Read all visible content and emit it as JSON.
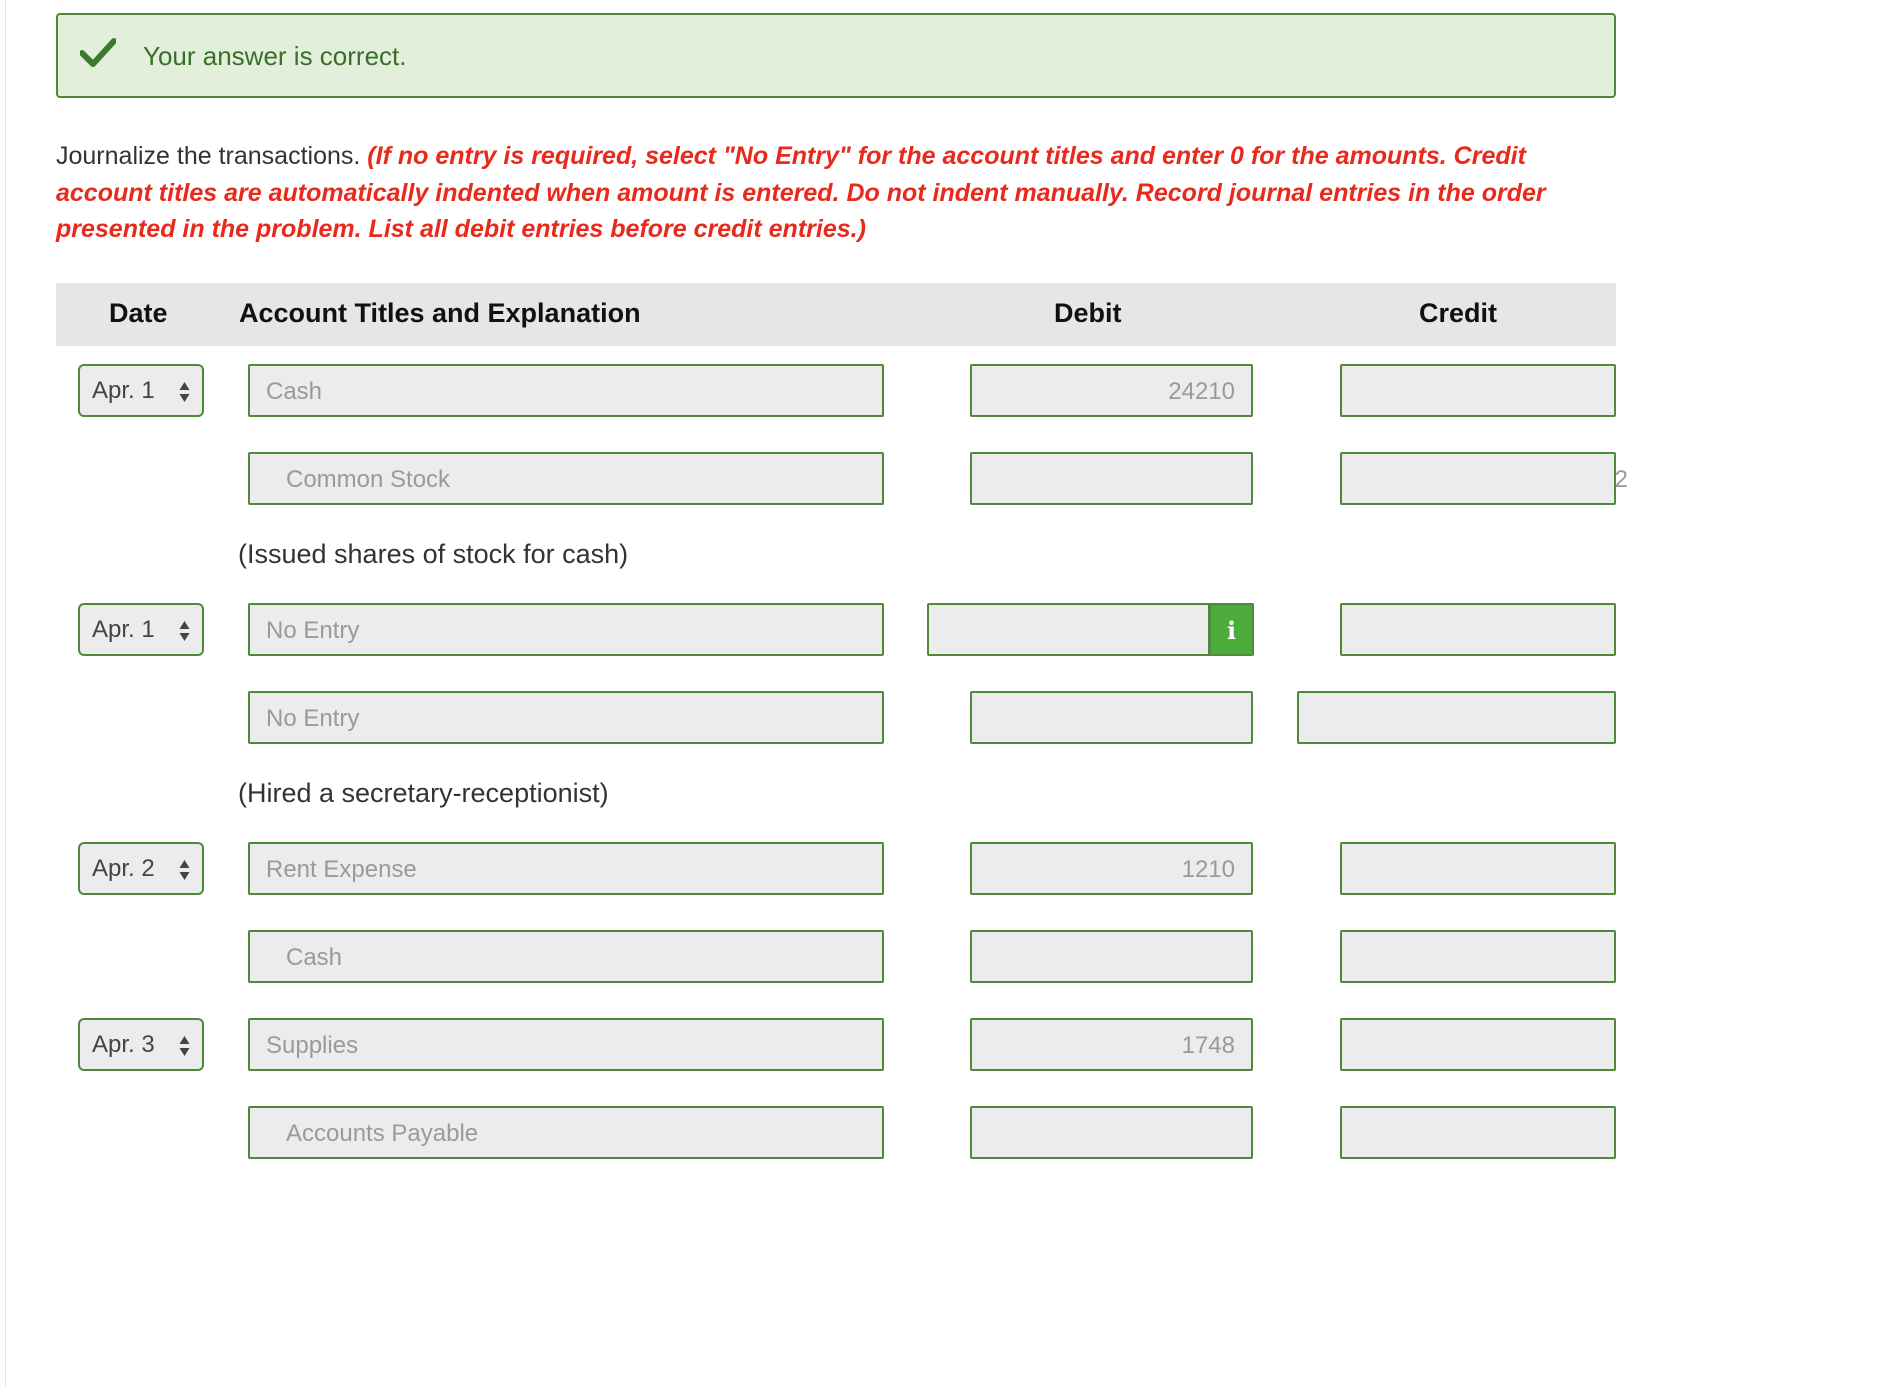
{
  "feedback": {
    "message": "Your answer is correct."
  },
  "instructions": {
    "lead": "Journalize the transactions.",
    "note": "(If no entry is required, select \"No Entry\" for the account titles and enter 0 for the amounts. Credit account titles are automatically indented when amount is entered. Do not indent manually. Record journal entries in the order presented in the problem. List all debit entries before credit entries.)"
  },
  "table": {
    "headers": {
      "date": "Date",
      "account": "Account Titles and Explanation",
      "debit": "Debit",
      "credit": "Credit"
    },
    "entries": [
      {
        "date": "Apr. 1",
        "lines": [
          {
            "account": "Cash",
            "debit": "24210",
            "credit": ""
          },
          {
            "account": "Common Stock",
            "debit": "",
            "credit": "2"
          }
        ],
        "explanation": "(Issued shares of stock for cash)"
      },
      {
        "date": "Apr. 1",
        "lines": [
          {
            "account": "No Entry",
            "debit": "",
            "credit": ""
          },
          {
            "account": "No Entry",
            "debit": "",
            "credit": ""
          }
        ],
        "explanation": "(Hired a secretary-receptionist)"
      },
      {
        "date": "Apr. 2",
        "lines": [
          {
            "account": "Rent Expense",
            "debit": "1210",
            "credit": ""
          },
          {
            "account": "Cash",
            "debit": "",
            "credit": ""
          }
        ]
      },
      {
        "date": "Apr. 3",
        "lines": [
          {
            "account": "Supplies",
            "debit": "1748",
            "credit": ""
          },
          {
            "account": "Accounts Payable",
            "debit": "",
            "credit": ""
          }
        ]
      }
    ]
  },
  "icons": {
    "check": "check-icon",
    "info": "info-icon",
    "select_arrows": "sort-arrows-icon"
  },
  "colors": {
    "banner_background": "#e2efdb",
    "success_green": "#4f8a3c",
    "info_green": "#4cab3b",
    "note_red": "#e8291c",
    "header_gray": "#e6e6e6",
    "field_gray": "#ececec"
  }
}
